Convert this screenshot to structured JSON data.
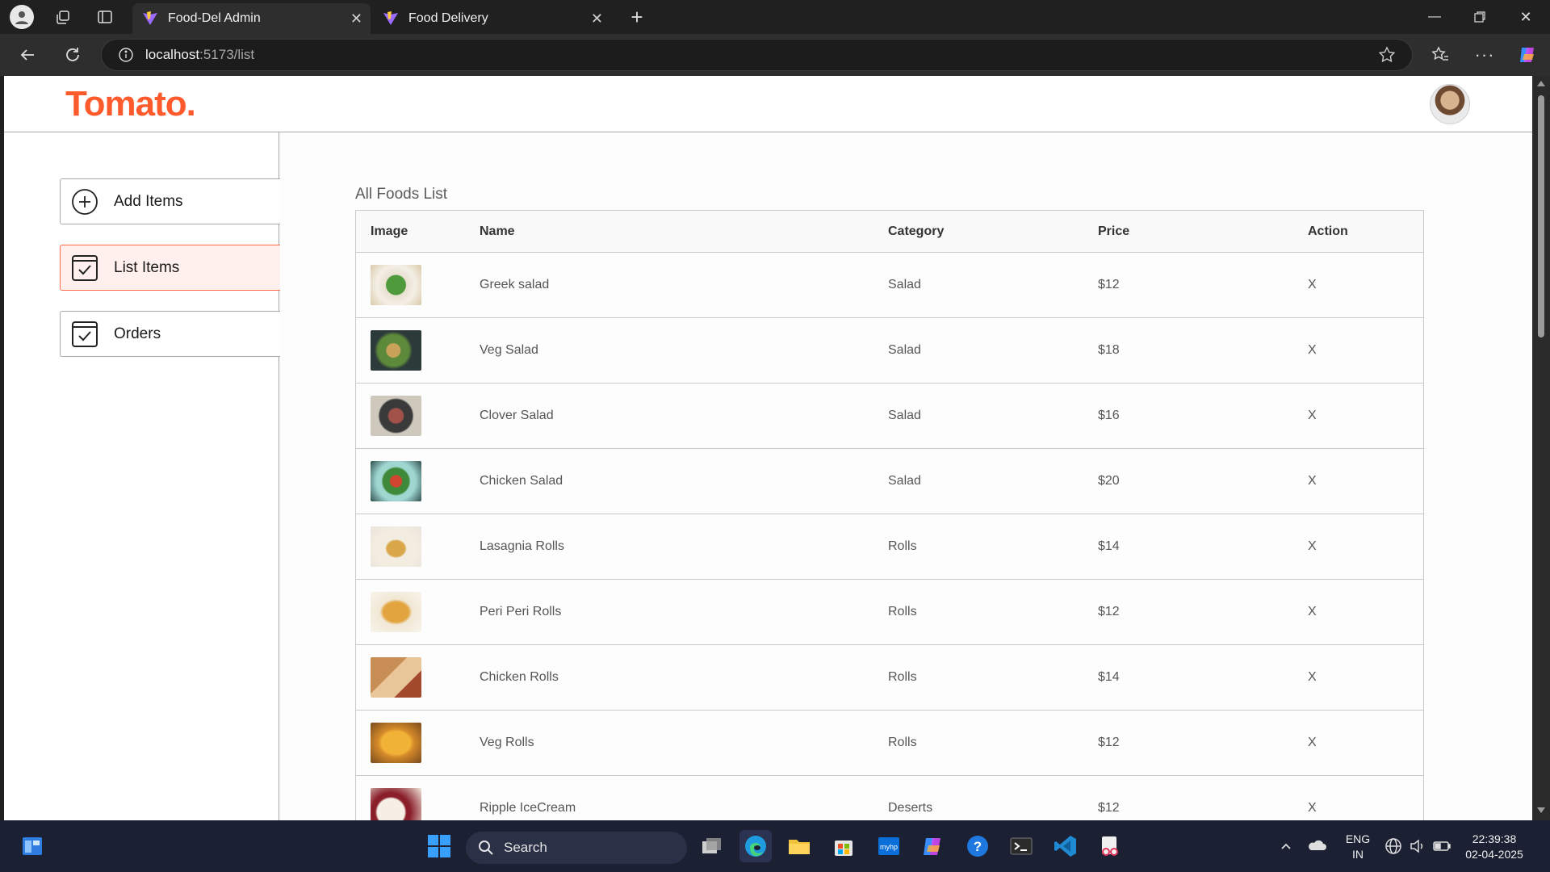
{
  "browser": {
    "tabs": [
      {
        "title": "Food-Del Admin",
        "active": true
      },
      {
        "title": "Food Delivery",
        "active": false
      }
    ],
    "url_host": "localhost",
    "url_rest": ":5173/list"
  },
  "app": {
    "logo": "Tomato",
    "logo_dot": ".",
    "accent_color": "#ff5a2c"
  },
  "sidebar": {
    "items": [
      {
        "label": "Add Items",
        "icon": "add-circle-icon",
        "active": false
      },
      {
        "label": "List Items",
        "icon": "checkbox-icon",
        "active": true
      },
      {
        "label": "Orders",
        "icon": "checkbox-icon",
        "active": false
      }
    ]
  },
  "main": {
    "title": "All Foods List",
    "columns": [
      "Image",
      "Name",
      "Category",
      "Price",
      "Action"
    ],
    "rows": [
      {
        "name": "Greek salad",
        "category": "Salad",
        "price": "$12",
        "action": "X"
      },
      {
        "name": "Veg Salad",
        "category": "Salad",
        "price": "$18",
        "action": "X"
      },
      {
        "name": "Clover Salad",
        "category": "Salad",
        "price": "$16",
        "action": "X"
      },
      {
        "name": "Chicken Salad",
        "category": "Salad",
        "price": "$20",
        "action": "X"
      },
      {
        "name": "Lasagnia Rolls",
        "category": "Rolls",
        "price": "$14",
        "action": "X"
      },
      {
        "name": "Peri Peri Rolls",
        "category": "Rolls",
        "price": "$12",
        "action": "X"
      },
      {
        "name": "Chicken Rolls",
        "category": "Rolls",
        "price": "$14",
        "action": "X"
      },
      {
        "name": "Veg Rolls",
        "category": "Rolls",
        "price": "$12",
        "action": "X"
      },
      {
        "name": "Ripple IceCream",
        "category": "Deserts",
        "price": "$12",
        "action": "X"
      }
    ]
  },
  "taskbar": {
    "search_label": "Search",
    "lang_line1": "ENG",
    "lang_line2": "IN",
    "time": "22:39:38",
    "date": "02-04-2025"
  }
}
